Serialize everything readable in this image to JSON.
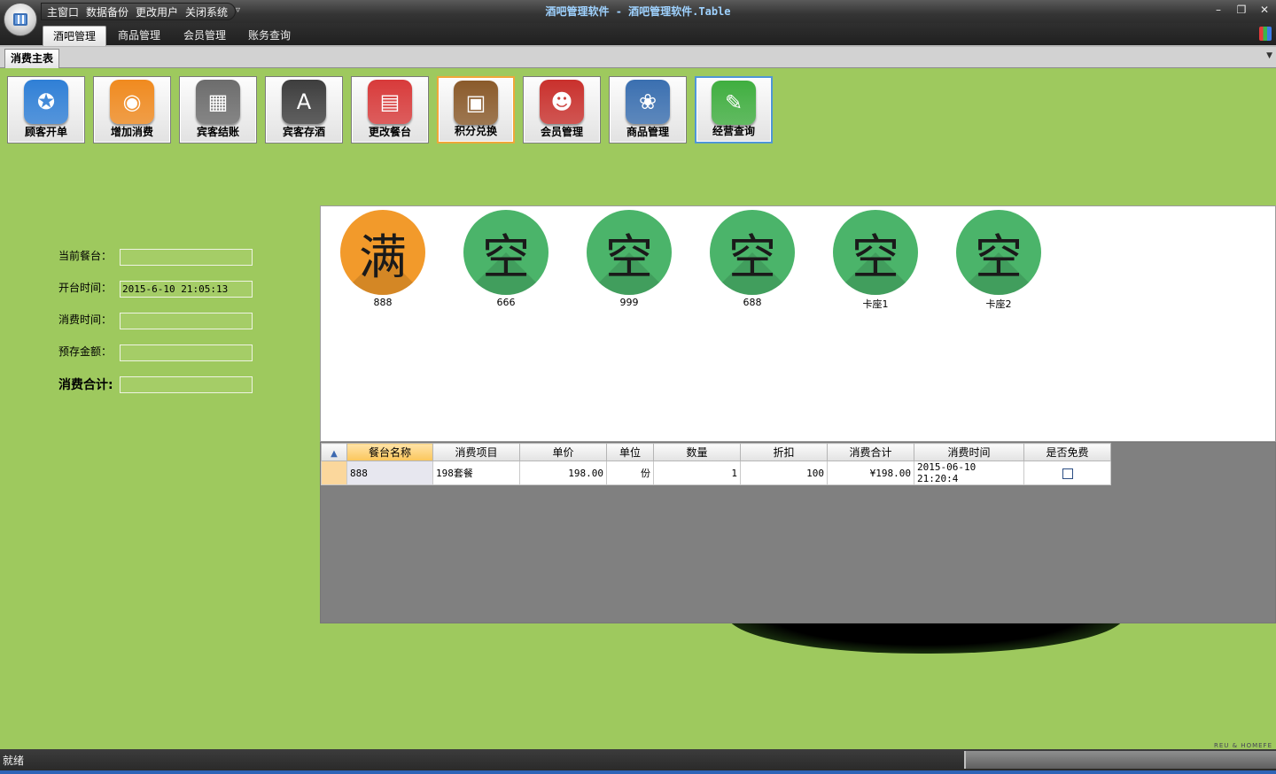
{
  "window": {
    "title": "酒吧管理软件 - 酒吧管理软件.Table",
    "quick_access": [
      "主窗口",
      "数据备份",
      "更改用户",
      "关闭系统"
    ],
    "controls": {
      "minimize": "–",
      "restore": "❐",
      "close": "✕"
    }
  },
  "ribbon": {
    "tabs": [
      "酒吧管理",
      "商品管理",
      "会员管理",
      "账务查询"
    ],
    "active_tab": "酒吧管理"
  },
  "doc_tab": "消费主表",
  "toolbar": [
    {
      "label": "顾客开单",
      "icon": "compass-icon",
      "color": "#2f7fd6",
      "glyph": "✪"
    },
    {
      "label": "增加消费",
      "icon": "ipod-icon",
      "color": "#f08a1f",
      "glyph": "◉"
    },
    {
      "label": "宾客结账",
      "icon": "calculator-icon",
      "color": "#6c6c6c",
      "glyph": "▦"
    },
    {
      "label": "宾客存酒",
      "icon": "appstore-icon",
      "color": "#3d3d3d",
      "glyph": "A"
    },
    {
      "label": "更改餐台",
      "icon": "calendar-icon",
      "color": "#d83a3a",
      "glyph": "▤"
    },
    {
      "label": "积分兑换",
      "icon": "board-icon",
      "color": "#8a5a2a",
      "glyph": "▣"
    },
    {
      "label": "会员管理",
      "icon": "member-icon",
      "color": "#c9302c",
      "glyph": "☻"
    },
    {
      "label": "商品管理",
      "icon": "photo-icon",
      "color": "#3a6fb0",
      "glyph": "❀"
    },
    {
      "label": "经营查询",
      "icon": "notes-icon",
      "color": "#3fae3f",
      "glyph": "✎"
    }
  ],
  "form": {
    "current_table": {
      "label": "当前餐台：",
      "value": ""
    },
    "open_time": {
      "label": "开台时间：",
      "value": "2015-6-10 21:05:13"
    },
    "consume_time": {
      "label": "消费时间：",
      "value": ""
    },
    "deposit": {
      "label": "预存金额：",
      "value": ""
    },
    "total": {
      "label": "消费合计:",
      "value": ""
    }
  },
  "tables": [
    {
      "status": "满",
      "name": "888",
      "state": "full"
    },
    {
      "status": "空",
      "name": "666",
      "state": "empty"
    },
    {
      "status": "空",
      "name": "999",
      "state": "empty"
    },
    {
      "status": "空",
      "name": "688",
      "state": "empty"
    },
    {
      "status": "空",
      "name": "卡座1",
      "state": "empty"
    },
    {
      "status": "空",
      "name": "卡座2",
      "state": "empty"
    }
  ],
  "grid": {
    "columns": [
      "餐台名称",
      "消费项目",
      "单价",
      "单位",
      "数量",
      "折扣",
      "消费合计",
      "消费时间",
      "是否免费"
    ],
    "rows": [
      [
        "888",
        "198套餐",
        "198.00",
        "份",
        "1",
        "100",
        "¥198.00",
        "2015-06-10 21:20:4",
        false
      ]
    ]
  },
  "status": {
    "text": "就绪"
  },
  "brand": "REU & HOMEFE"
}
